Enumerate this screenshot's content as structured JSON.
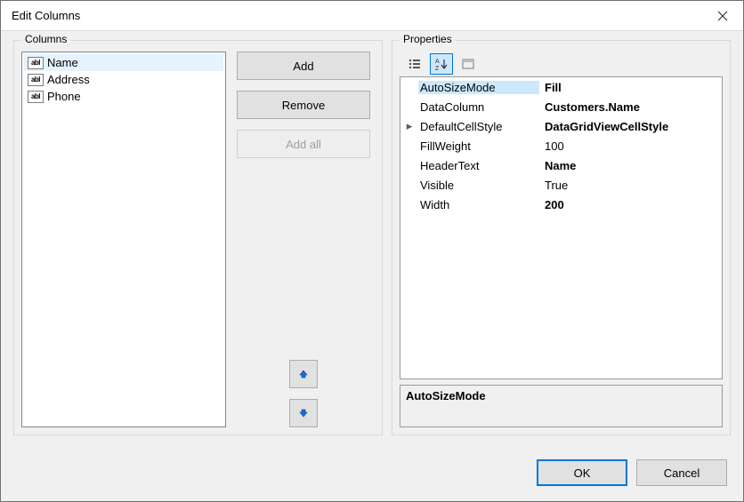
{
  "window": {
    "title": "Edit Columns"
  },
  "columns": {
    "legend": "Columns",
    "items": [
      {
        "label": "Name"
      },
      {
        "label": "Address"
      },
      {
        "label": "Phone"
      }
    ],
    "buttons": {
      "add": "Add",
      "remove": "Remove",
      "addAll": "Add all"
    }
  },
  "properties": {
    "legend": "Properties",
    "rows": [
      {
        "name": "AutoSizeMode",
        "value": "Fill",
        "bold": true,
        "selected": true
      },
      {
        "name": "DataColumn",
        "value": "Customers.Name",
        "bold": true
      },
      {
        "name": "DefaultCellStyle",
        "value": "DataGridViewCellStyle",
        "bold": true,
        "expandable": true
      },
      {
        "name": "FillWeight",
        "value": "100",
        "bold": false
      },
      {
        "name": "HeaderText",
        "value": "Name",
        "bold": true
      },
      {
        "name": "Visible",
        "value": "True",
        "bold": false
      },
      {
        "name": "Width",
        "value": "200",
        "bold": true
      }
    ],
    "description": {
      "name": "AutoSizeMode",
      "text": ""
    }
  },
  "footer": {
    "ok": "OK",
    "cancel": "Cancel"
  }
}
